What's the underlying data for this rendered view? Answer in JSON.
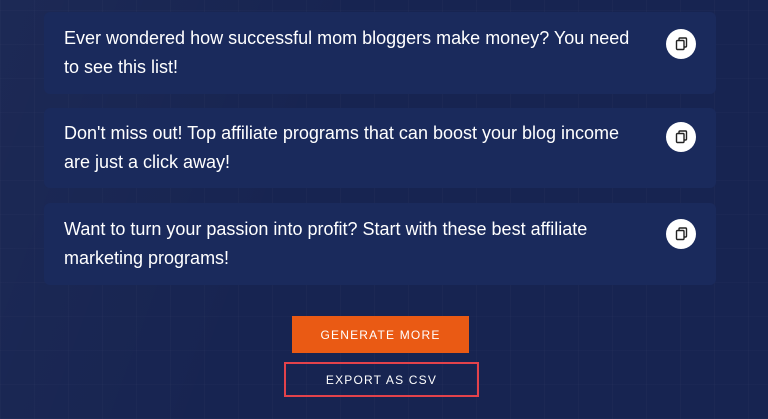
{
  "results": [
    {
      "text": "Ever wondered how successful mom bloggers make money? You need to see this list!",
      "copy_icon": "copy-icon"
    },
    {
      "text": "Don't miss out! Top affiliate programs that can boost your blog income are just a click away!",
      "copy_icon": "copy-icon"
    },
    {
      "text": "Want to turn your passion into profit? Start with these best affiliate marketing programs!",
      "copy_icon": "copy-icon"
    }
  ],
  "actions": {
    "generate_label": "GENERATE MORE",
    "export_label": "EXPORT AS CSV"
  },
  "colors": {
    "background": "#172451",
    "card": "#1a2a5c",
    "accent": "#ea5a14",
    "highlight_border": "#e3424b"
  }
}
